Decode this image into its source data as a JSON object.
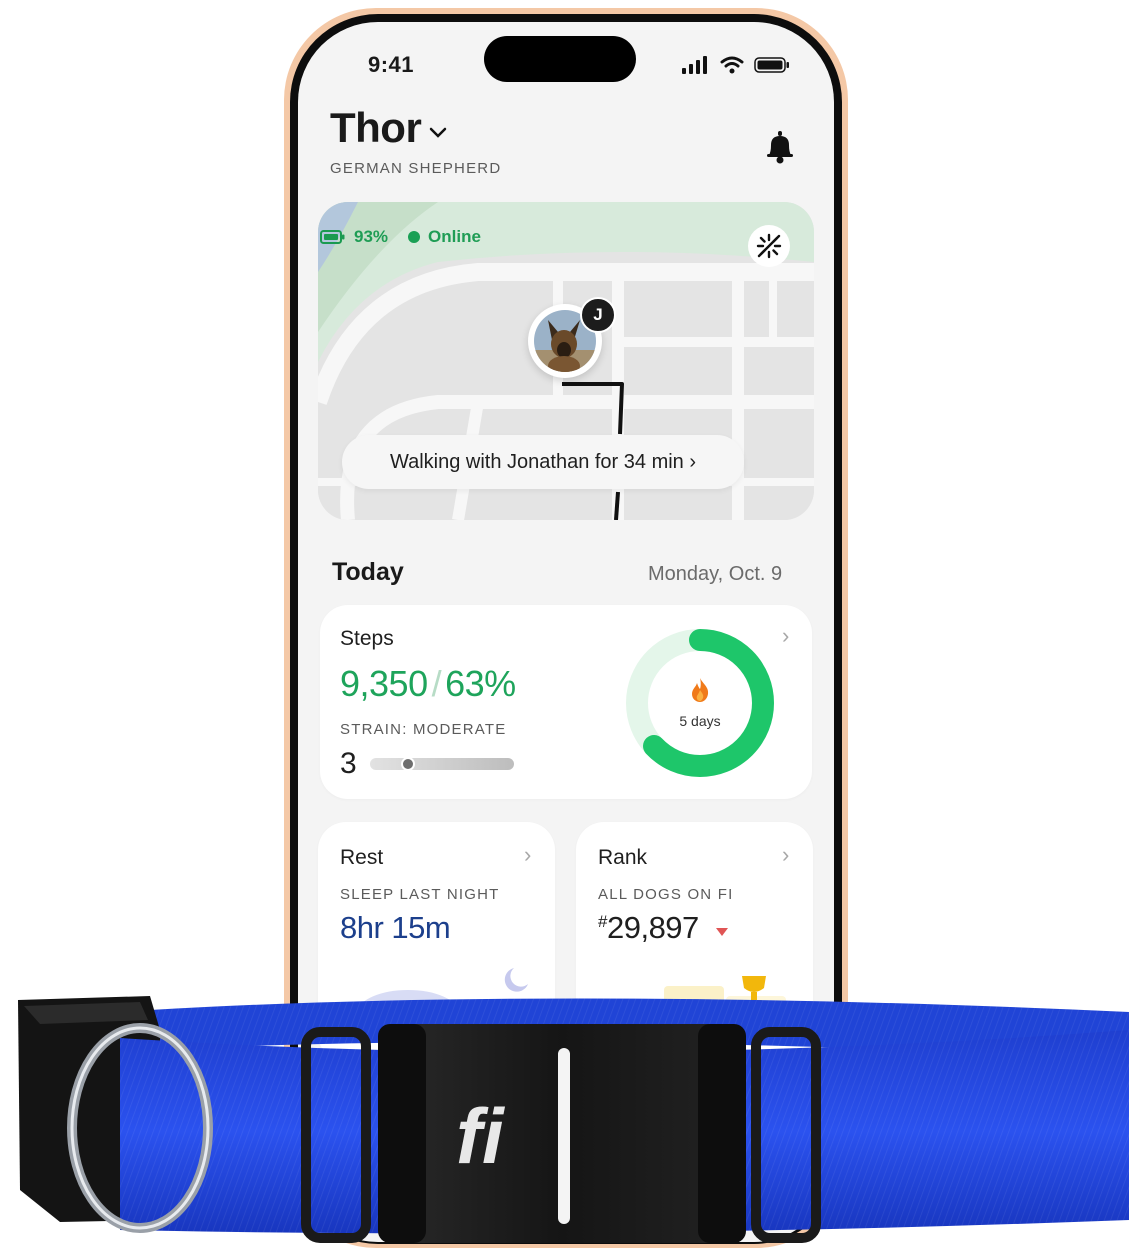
{
  "status_bar": {
    "time": "9:41"
  },
  "header": {
    "pet_name": "Thor",
    "breed": "GERMAN SHEPHERD"
  },
  "map": {
    "battery": "93%",
    "connection": "Online",
    "walker_initial": "J",
    "activity_text": "Walking with Jonathan for 34 min ›"
  },
  "today": {
    "label": "Today",
    "date": "Monday, Oct. 9"
  },
  "steps": {
    "title": "Steps",
    "count": "9,350",
    "percent": "63%",
    "strain_label": "STRAIN: MODERATE",
    "strain_value": "3",
    "streak": "5 days",
    "goal_progress": 0.63
  },
  "rest": {
    "title": "Rest",
    "sub_label": "SLEEP LAST NIGHT",
    "value": "8hr 15m"
  },
  "rank": {
    "title": "Rank",
    "sub_label": "ALL DOGS ON FI",
    "hash": "#",
    "value": "29,897"
  },
  "collar": {
    "brand": "fi"
  },
  "colors": {
    "accent_green": "#1ea45b",
    "rest_blue": "#1c3f8c",
    "collar_blue": "#2347d6",
    "phone_frame": "#f4c8a6"
  },
  "icons": [
    "chevron-down-icon",
    "bell-icon",
    "battery-icon",
    "online-dot-icon",
    "sparkle-icon",
    "flame-icon",
    "chevron-right-icon",
    "moon-icon",
    "trophy-icon"
  ]
}
